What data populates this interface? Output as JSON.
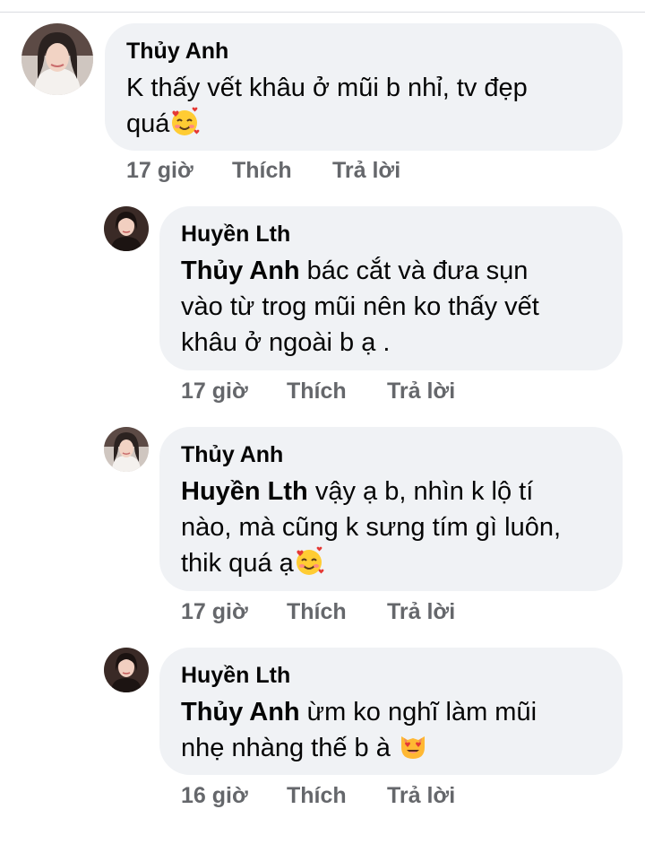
{
  "comments": [
    {
      "author": "Thủy Anh",
      "lines": [
        {
          "mention": "",
          "text": "K thấy vết khâu ở mũi b nhỉ, tv đẹp"
        },
        {
          "mention": "",
          "text": "quá",
          "emoji": "smiling-face-with-hearts"
        }
      ],
      "time": "17 giờ",
      "like_label": "Thích",
      "reply_label": "Trả lời"
    },
    {
      "author": "Huyền Lth",
      "lines": [
        {
          "mention": "Thủy Anh",
          "text": " bác cắt và đưa sụn"
        },
        {
          "mention": "",
          "text": "vào từ trog mũi nên ko thấy vết"
        },
        {
          "mention": "",
          "text": "khâu ở ngoài b ạ ."
        }
      ],
      "time": "17 giờ",
      "like_label": "Thích",
      "reply_label": "Trả lời"
    },
    {
      "author": "Thủy Anh",
      "lines": [
        {
          "mention": "Huyền Lth",
          "text": " vậy ạ b, nhìn k lộ tí"
        },
        {
          "mention": "",
          "text": "nào, mà cũng k sưng tím gì luôn,"
        },
        {
          "mention": "",
          "text": "thik quá ạ",
          "emoji": "smiling-face-with-hearts"
        }
      ],
      "time": "17 giờ",
      "like_label": "Thích",
      "reply_label": "Trả lời"
    },
    {
      "author": "Huyền Lth",
      "lines": [
        {
          "mention": "Thủy Anh",
          "text": " ừm ko nghĩ làm mũi"
        },
        {
          "mention": "",
          "text": "nhẹ nhàng thế b à ",
          "emoji": "smiling-cat-with-heart-eyes"
        }
      ],
      "time": "16 giờ",
      "like_label": "Thích",
      "reply_label": "Trả lời"
    }
  ],
  "colors": {
    "bubble_bg": "#f0f2f5",
    "meta_text": "#65676b",
    "body_text": "#050505"
  }
}
